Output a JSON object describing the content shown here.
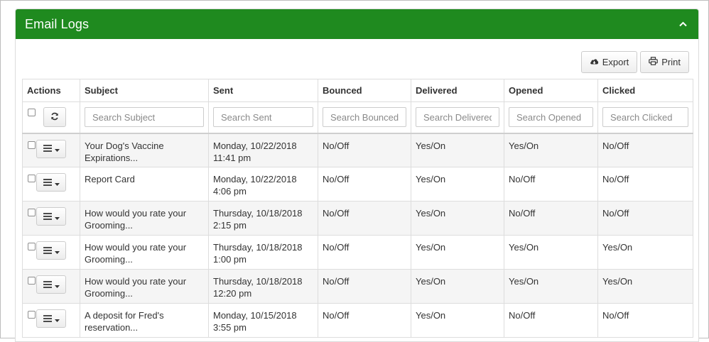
{
  "panel": {
    "title": "Email Logs",
    "header_color": "#1f8a1f",
    "collapse_icon": "chevron-up-icon"
  },
  "toolbar": {
    "export_label": "Export",
    "export_icon": "cloud-download-icon",
    "print_label": "Print",
    "print_icon": "printer-icon"
  },
  "table": {
    "columns": [
      "Actions",
      "Subject",
      "Sent",
      "Bounced",
      "Delivered",
      "Opened",
      "Clicked"
    ],
    "filters": {
      "subject": "Search Subject",
      "sent": "Search Sent",
      "bounced": "Search Bounced",
      "delivered": "Search Delivered",
      "opened": "Search Opened",
      "clicked": "Search Clicked"
    },
    "rows": [
      {
        "subject_line1": "Your Dog's Vaccine",
        "subject_line2": "Expirations...",
        "sent_date": "Monday, 10/22/2018",
        "sent_time": "11:41 pm",
        "bounced": "No/Off",
        "delivered": "Yes/On",
        "opened": "Yes/On",
        "clicked": "No/Off"
      },
      {
        "subject_line1": "Report Card",
        "subject_line2": "",
        "sent_date": "Monday, 10/22/2018",
        "sent_time": "4:06 pm",
        "bounced": "No/Off",
        "delivered": "Yes/On",
        "opened": "No/Off",
        "clicked": "No/Off"
      },
      {
        "subject_line1": "How would you rate your",
        "subject_line2": "Grooming...",
        "sent_date": "Thursday, 10/18/2018",
        "sent_time": "2:15 pm",
        "bounced": "No/Off",
        "delivered": "Yes/On",
        "opened": "No/Off",
        "clicked": "No/Off"
      },
      {
        "subject_line1": "How would you rate your",
        "subject_line2": "Grooming...",
        "sent_date": "Thursday, 10/18/2018",
        "sent_time": "1:00 pm",
        "bounced": "No/Off",
        "delivered": "Yes/On",
        "opened": "Yes/On",
        "clicked": "Yes/On"
      },
      {
        "subject_line1": "How would you rate your",
        "subject_line2": "Grooming...",
        "sent_date": "Thursday, 10/18/2018",
        "sent_time": "12:20 pm",
        "bounced": "No/Off",
        "delivered": "Yes/On",
        "opened": "Yes/On",
        "clicked": "Yes/On"
      },
      {
        "subject_line1": "A deposit for Fred's",
        "subject_line2": "reservation...",
        "sent_date": "Monday, 10/15/2018",
        "sent_time": "3:55 pm",
        "bounced": "No/Off",
        "delivered": "Yes/On",
        "opened": "No/Off",
        "clicked": "No/Off"
      }
    ]
  }
}
